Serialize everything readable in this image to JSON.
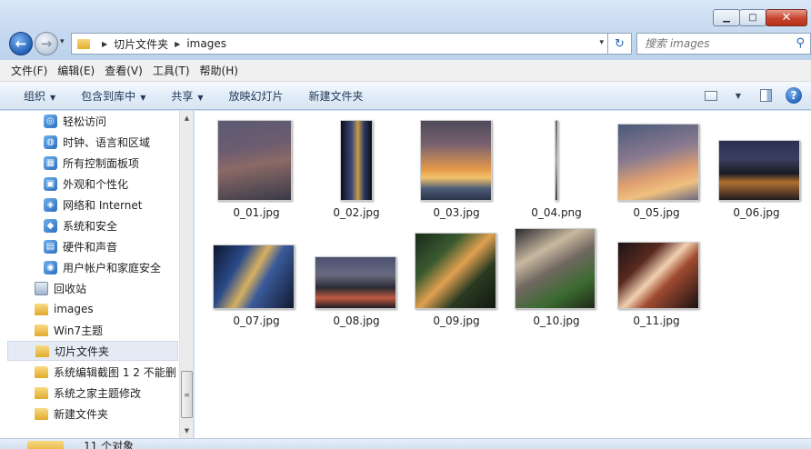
{
  "window": {
    "minimize_glyph": "▁",
    "maximize_glyph": "□",
    "close_glyph": "✕"
  },
  "nav": {
    "back_glyph": "←",
    "forward_glyph": "→",
    "recent_glyph": "▾",
    "breadcrumb": [
      "切片文件夹",
      "images"
    ],
    "breadcrumb_sep": "▶",
    "address_dropdown": "▾",
    "refresh_glyph": "↻",
    "search_placeholder": "搜索 images",
    "search_glyph": "⚲"
  },
  "menubar": {
    "items": [
      "文件(F)",
      "编辑(E)",
      "查看(V)",
      "工具(T)",
      "帮助(H)"
    ]
  },
  "commandbar": {
    "organize": "组织",
    "include_in_library": "包含到库中",
    "share": "共享",
    "slideshow": "放映幻灯片",
    "new_folder": "新建文件夹",
    "arrow": "▼",
    "views_dropdown": "▼",
    "help_glyph": "?"
  },
  "navpane": {
    "control_panel_items": [
      {
        "label": "轻松访问",
        "icon": "ease-of-access-icon"
      },
      {
        "label": "时钟、语言和区域",
        "icon": "clock-language-region-icon"
      },
      {
        "label": "所有控制面板项",
        "icon": "all-control-panel-items-icon"
      },
      {
        "label": "外观和个性化",
        "icon": "appearance-personalization-icon"
      },
      {
        "label": "网络和 Internet",
        "icon": "network-internet-icon"
      },
      {
        "label": "系统和安全",
        "icon": "system-security-icon"
      },
      {
        "label": "硬件和声音",
        "icon": "hardware-sound-icon"
      },
      {
        "label": "用户帐户和家庭安全",
        "icon": "user-accounts-icon"
      }
    ],
    "recycle_bin": "回收站",
    "folders": [
      "images",
      "Win7主题",
      "切片文件夹",
      "系统编辑截图 1 2  不能删",
      "系统之家主题修改",
      "新建文件夹"
    ],
    "selected": "切片文件夹",
    "scroll_up": "▲",
    "scroll_down": "▼",
    "thumb_grip": "≡"
  },
  "files": [
    {
      "name": "0_01.jpg",
      "kind": "storm-sky"
    },
    {
      "name": "0_02.jpg",
      "kind": "tower-night"
    },
    {
      "name": "0_03.jpg",
      "kind": "sunset-dome"
    },
    {
      "name": "0_04.png",
      "kind": "thin-strip"
    },
    {
      "name": "0_05.jpg",
      "kind": "sunset-clouds"
    },
    {
      "name": "0_06.jpg",
      "kind": "city-lights"
    },
    {
      "name": "0_07.jpg",
      "kind": "tower-lights"
    },
    {
      "name": "0_08.jpg",
      "kind": "city-road"
    },
    {
      "name": "0_09.jpg",
      "kind": "aerial-trees"
    },
    {
      "name": "0_10.jpg",
      "kind": "curved-building"
    },
    {
      "name": "0_11.jpg",
      "kind": "light-trails"
    }
  ],
  "statusbar": {
    "text": "11 个对象"
  }
}
